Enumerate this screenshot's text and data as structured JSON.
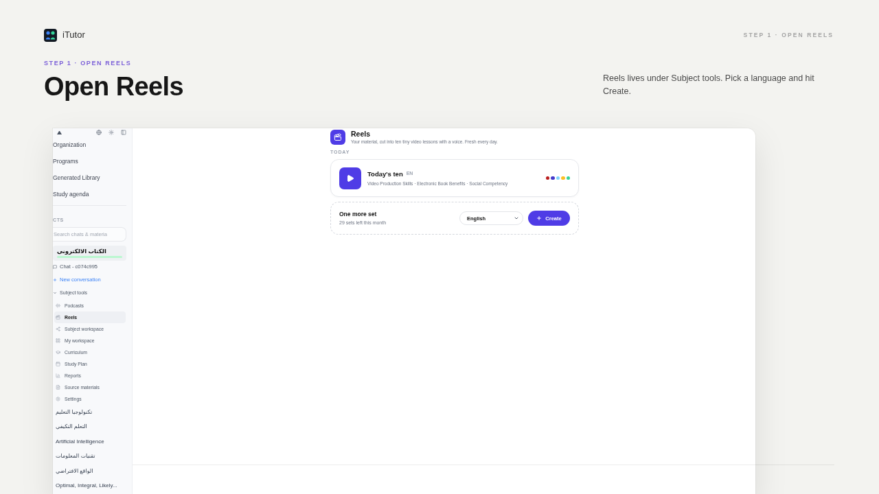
{
  "brand": {
    "name": "iTutor"
  },
  "step_tag": "STEP 1 · OPEN REELS",
  "hero": {
    "eyebrow": "STEP 1 · OPEN REELS",
    "title": "Open Reels",
    "description": "Reels lives under Subject tools. Pick a language and hit Create."
  },
  "sidebar": {
    "nav_items": [
      "Organization",
      "Programs",
      "Generated Library",
      "Study agenda"
    ],
    "section_label": "CTS",
    "search": {
      "placeholder": "Search chats & materia"
    },
    "subjects": [
      {
        "label": "الكتاب الالكتروني",
        "selected": true,
        "children": [
          {
            "kind": "chat",
            "label": "Chat - c074c995"
          },
          {
            "kind": "new",
            "label": "New conversation"
          },
          {
            "kind": "group",
            "label": "Subject tools",
            "expanded": true,
            "children": [
              {
                "kind": "podcasts",
                "label": "Podcasts",
                "selected": false
              },
              {
                "kind": "reels",
                "label": "Reels",
                "selected": true
              },
              {
                "kind": "subject_workspace",
                "label": "Subject workspace",
                "selected": false
              },
              {
                "kind": "my_workspace",
                "label": "My workspace",
                "selected": false
              },
              {
                "kind": "curriculum",
                "label": "Curriculum",
                "selected": false
              },
              {
                "kind": "study_plan",
                "label": "Study Plan",
                "selected": false
              },
              {
                "kind": "reports",
                "label": "Reports",
                "selected": false
              },
              {
                "kind": "sources",
                "label": "Source materials",
                "selected": false
              },
              {
                "kind": "settings",
                "label": "Settings",
                "selected": false
              }
            ]
          }
        ]
      },
      {
        "label": "تكنولوجيا التعليم",
        "selected": false
      },
      {
        "label": "التعلم التكيفي",
        "selected": false
      },
      {
        "label": "Artificial Intelligence",
        "selected": false
      },
      {
        "label": "تقنيات المعلومات",
        "selected": false
      },
      {
        "label": "الواقع الافتراضي",
        "selected": false
      },
      {
        "label": "Optimal, Integral, Likely...",
        "selected": false
      }
    ]
  },
  "reels": {
    "title": "Reels",
    "subtitle": "Your material, cut into ten tiny video lessons with a voice. Fresh every day.",
    "section_label": "TODAY",
    "today": {
      "title": "Today's ten",
      "language": "EN",
      "topics": "Video Production Skills · Electronic Book Benefits · Social Competency",
      "dots": [
        {
          "color": "#b91c1c"
        },
        {
          "color": "#4338ca"
        },
        {
          "color": "#7dd3fc"
        },
        {
          "color": "#fbbf24"
        },
        {
          "color": "#34d399"
        }
      ]
    },
    "more": {
      "title": "One more set",
      "quota": "29 sets left this month",
      "language": "English",
      "create_label": "Create"
    }
  }
}
